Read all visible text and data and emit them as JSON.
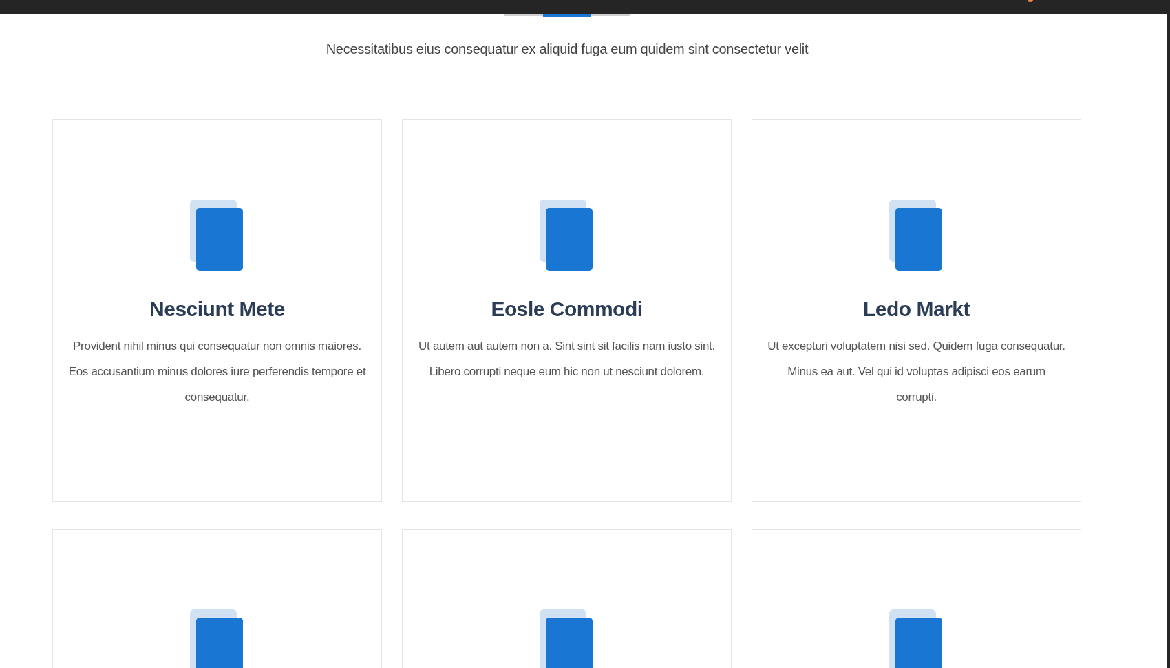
{
  "section": {
    "subtitle": "Necessitatibus eius consequatur ex aliquid fuga eum quidem sint consectetur velit"
  },
  "cards": [
    {
      "kind": "service",
      "title": "Nesciunt Mete",
      "text": "Provident nihil minus qui consequatur non omnis maiores. Eos accusantium minus dolores iure perferendis tempore et consequatur."
    },
    {
      "kind": "service",
      "title": "Eosle Commodi",
      "text": "Ut autem aut autem non a. Sint sint sit facilis nam iusto sint. Libero corrupti neque eum hic non ut nesciunt dolorem."
    },
    {
      "kind": "service",
      "title": "Ledo Markt",
      "text": "Ut excepturi voluptatem nisi sed. Quidem fuga consequatur. Minus ea aut. Vel qui id voluptas adipisci eos earum corrupti."
    },
    {
      "kind": "service"
    },
    {
      "kind": "service"
    },
    {
      "kind": "service"
    }
  ]
}
